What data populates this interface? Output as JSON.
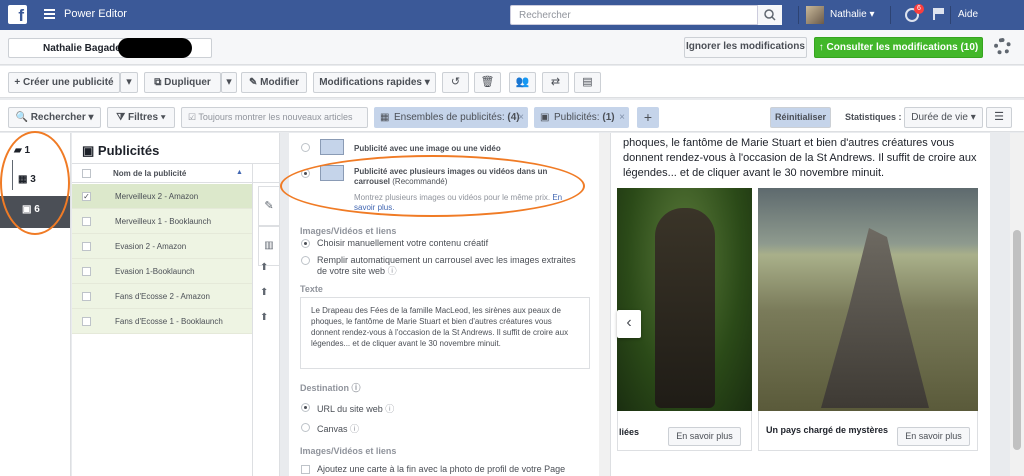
{
  "topbar": {
    "app_title": "Power Editor",
    "search_placeholder": "Rechercher",
    "user_name": "Nathalie",
    "notif_count": "6",
    "help": "Aide"
  },
  "account": {
    "name": "Nathalie Bagadey"
  },
  "actions": {
    "discard": "Ignorer les modifications",
    "review": "Consulter les modifications (10)"
  },
  "toolbar": {
    "create": "Créer une publicité",
    "duplicate": "Dupliquer",
    "edit": "Modifier",
    "quick_edit": "Modifications rapides"
  },
  "filterbar": {
    "search": "Rechercher",
    "filters": "Filtres",
    "always_show_new": "Toujours montrer les nouveaux articles",
    "adsets_chip": "Ensembles de publicités:",
    "adsets_count": "(4)",
    "ads_chip": "Publicités:",
    "ads_count": "(1)",
    "reset": "Réinitialiser",
    "stats_label": "Statistiques :",
    "stats_value": "Durée de vie"
  },
  "leftnav": {
    "campaigns": "1",
    "adsets": "3",
    "ads": "6"
  },
  "panel": {
    "title": "Publicités",
    "col_name": "Nom de la publicité",
    "rows": [
      {
        "name": "Merveilleux 2 - Amazon"
      },
      {
        "name": "Merveilleux 1 - Booklaunch"
      },
      {
        "name": "Evasion 2 - Amazon"
      },
      {
        "name": "Evasion 1-Booklaunch"
      },
      {
        "name": "Fans d'Ecosse 2 - Amazon"
      },
      {
        "name": "Fans d'Ecosse 1 - Booklaunch"
      }
    ]
  },
  "editor": {
    "opt_single": "Publicité avec une image ou une vidéo",
    "opt_carousel": "Publicité avec plusieurs images ou vidéos dans un carrousel",
    "recommended": "(Recommandé)",
    "carousel_desc": "Montrez plusieurs images ou vidéos pour le même prix.",
    "learn_more": "En savoir plus.",
    "media_label": "Images/Vidéos et liens",
    "manual": "Choisir manuellement votre contenu créatif",
    "auto": "Remplir automatiquement un carrousel avec les images extraites de votre site web",
    "text_label": "Texte",
    "text_value": "Le Drapeau des Fées de la famille MacLeod, les sirènes aux peaux de phoques, le fantôme de Marie Stuart et bien d'autres créatures vous donnent rendez-vous à l'occasion de la St Andrews. Il suffit de croire aux légendes... et de cliquer avant le 30 novembre minuit.",
    "dest_label": "Destination",
    "dest_url": "URL du site web",
    "dest_canvas": "Canvas",
    "media_label2": "Images/Vidéos et liens",
    "end_card": "Ajoutez une carte à la fin avec la photo de profil de votre Page"
  },
  "preview": {
    "body": "phoques, le fantôme de Marie Stuart et bien d'autres créatures vous donnent rendez-vous à l'occasion de la St Andrews. Il suffit de croire aux légendes... et de cliquer avant le 30 novembre minuit.",
    "card1_title": "liées",
    "card2_title": "Un pays chargé de mystères",
    "cta": "En savoir plus"
  },
  "colors": {
    "fb_blue": "#3b5998",
    "green": "#42b72a",
    "annotation": "#f07b25",
    "chip": "#c5d4ea",
    "selected_row": "#eef4e3"
  }
}
